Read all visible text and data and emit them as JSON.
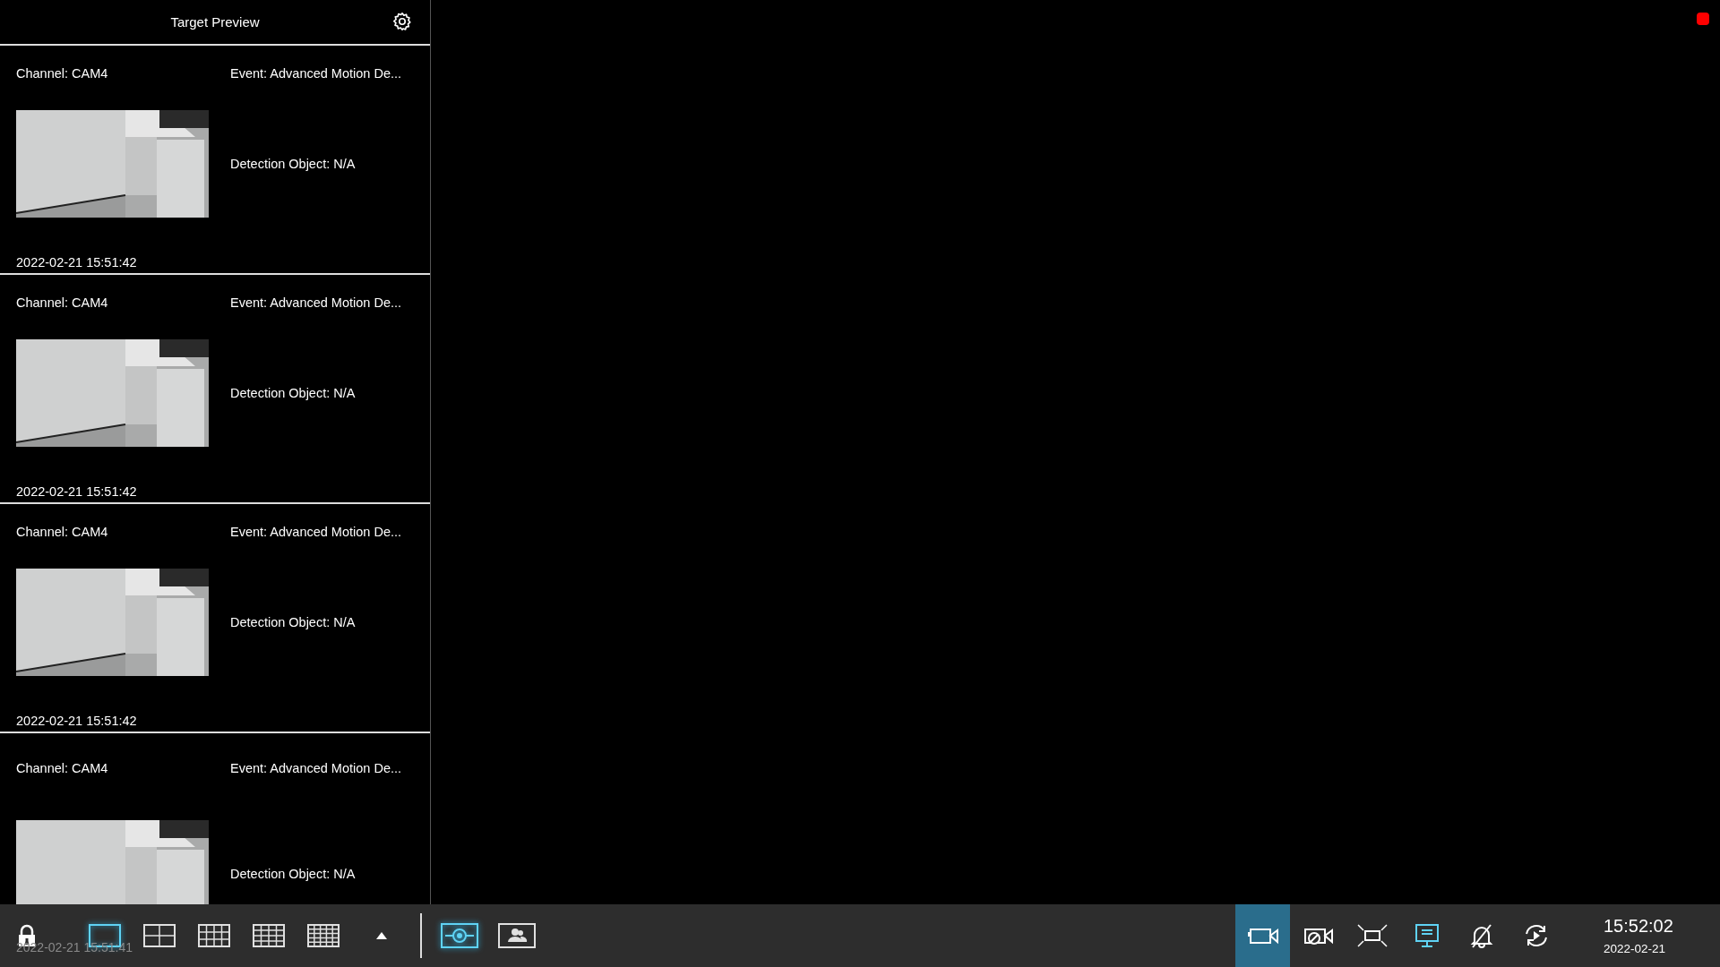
{
  "panel": {
    "title": "Target Preview",
    "cards": [
      {
        "channel": "Channel: CAM4",
        "event": "Event: Advanced Motion De...",
        "detection": "Detection Object: N/A",
        "time": "2022-02-21 15:51:42"
      },
      {
        "channel": "Channel: CAM4",
        "event": "Event: Advanced Motion De...",
        "detection": "Detection Object: N/A",
        "time": "2022-02-21 15:51:42"
      },
      {
        "channel": "Channel: CAM4",
        "event": "Event: Advanced Motion De...",
        "detection": "Detection Object: N/A",
        "time": "2022-02-21 15:51:42"
      },
      {
        "channel": "Channel: CAM4",
        "event": "Event: Advanced Motion De...",
        "detection": "Detection Object: N/A"
      }
    ]
  },
  "recording": true,
  "toolbar": {
    "ghost_time": "2022-02-21 15:51:41",
    "layouts": [
      {
        "kind": "split-1",
        "selected": true
      },
      {
        "kind": "split-4",
        "selected": false
      },
      {
        "kind": "split-12",
        "selected": false
      },
      {
        "kind": "split-16",
        "selected": false
      },
      {
        "kind": "split-25",
        "selected": false
      }
    ],
    "views": [
      {
        "kind": "target",
        "selected": true
      },
      {
        "kind": "people",
        "selected": false
      }
    ],
    "tools": [
      {
        "kind": "camera",
        "selected": true
      },
      {
        "kind": "camera-off",
        "selected": false
      },
      {
        "kind": "fit",
        "selected": false
      },
      {
        "kind": "monitor",
        "selected": true
      },
      {
        "kind": "bell-off",
        "selected": false
      },
      {
        "kind": "sequence",
        "selected": false
      }
    ],
    "time": "15:52:02",
    "date": "2022-02-21"
  }
}
